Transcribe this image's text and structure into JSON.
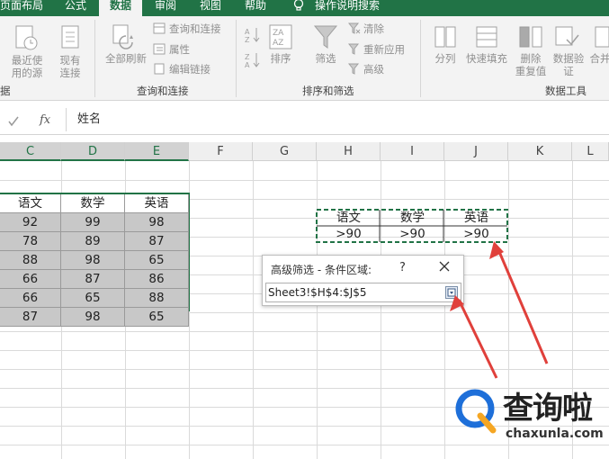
{
  "tabs": [
    {
      "label": "页面布局"
    },
    {
      "label": "公式"
    },
    {
      "label": "数据"
    },
    {
      "label": "审阅"
    },
    {
      "label": "视图"
    },
    {
      "label": "帮助"
    },
    {
      "label": "操作说明搜索"
    }
  ],
  "ribbon": {
    "get_data": {
      "recent_line1": "最近使",
      "recent_line2": "用的源",
      "existing_line1": "现有",
      "existing_line2": "连接",
      "group_label": "据"
    },
    "queries": {
      "refresh_all": "全部刷新",
      "queries_connections": "查询和连接",
      "properties": "属性",
      "edit_links": "编辑链接",
      "group_label": "查询和连接"
    },
    "sort_filter": {
      "sort": "排序",
      "filter": "筛选",
      "clear": "清除",
      "reapply": "重新应用",
      "advanced": "高级",
      "group_label": "排序和筛选"
    },
    "data_tools": {
      "text_to_columns": "分列",
      "flash_fill": "快速填充",
      "remove_dup_line1": "删除",
      "remove_dup_line2": "重复值",
      "validation_line1": "数据验",
      "validation_line2": "证",
      "consolidate": "合并",
      "group_label": "数据工具"
    }
  },
  "formula_bar": {
    "fx": "fx",
    "content": "姓名"
  },
  "columns": [
    "C",
    "D",
    "E",
    "F",
    "G",
    "H",
    "I",
    "J",
    "K",
    "L"
  ],
  "table": {
    "headers": [
      "语文",
      "数学",
      "英语"
    ],
    "rows": [
      [
        "92",
        "99",
        "98"
      ],
      [
        "78",
        "89",
        "87"
      ],
      [
        "88",
        "98",
        "65"
      ],
      [
        "66",
        "87",
        "86"
      ],
      [
        "66",
        "65",
        "88"
      ],
      [
        "87",
        "98",
        "65"
      ]
    ]
  },
  "criteria": {
    "headers": [
      "语文",
      "数学",
      "英语"
    ],
    "values": [
      ">90",
      ">90",
      ">90"
    ]
  },
  "dialog": {
    "title": "高级筛选 - 条件区域:",
    "help": "?",
    "value": "Sheet3!$H$4:$J$5"
  },
  "watermark": {
    "brand": "查询啦",
    "url": "chaxunla.com"
  },
  "colors": {
    "excel_green": "#217346",
    "arrow_red": "#e0403b",
    "selection_gray": "#c8c8c8"
  }
}
